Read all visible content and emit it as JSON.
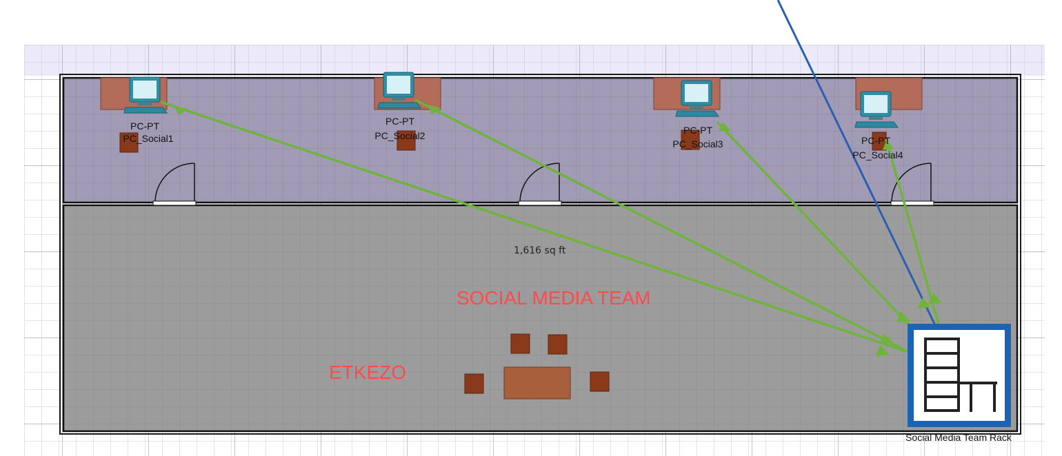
{
  "floor": {
    "area": "1,616 sq ft",
    "zone_label": "SOCIAL MEDIA TEAM",
    "dining_label": "ETKEZO"
  },
  "devices": [
    {
      "type": "PC-PT",
      "name": "PC_Social1"
    },
    {
      "type": "PC-PT",
      "name": "PC_Social2"
    },
    {
      "type": "PC-PT",
      "name": "PC_Social3"
    },
    {
      "type": "PC-PT",
      "name": "PC_Social4"
    }
  ],
  "rack": {
    "name": "Social Media Team Rack",
    "icon": "rack-icon"
  },
  "colors": {
    "link_green": "#6fb23c",
    "uplink_blue": "#2a5fb0",
    "label_red": "#ff4a4a",
    "rack_border": "#1d63b4"
  }
}
